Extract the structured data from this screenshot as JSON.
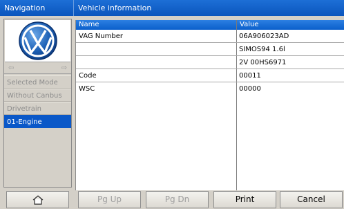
{
  "window": {
    "nav_title": "Navigation",
    "main_title": "Vehicle information"
  },
  "logo": {
    "brand": "VW",
    "icon": "vw-logo-icon"
  },
  "nav": {
    "arrow_left": "⇦",
    "arrow_right": "⇨",
    "items": [
      {
        "label": "Selected Mode",
        "selected": false
      },
      {
        "label": "Without Canbus",
        "selected": false
      },
      {
        "label": "Drivetrain",
        "selected": false
      },
      {
        "label": "01-Engine",
        "selected": true
      }
    ]
  },
  "table": {
    "headers": {
      "name": "Name",
      "value": "Value"
    },
    "rows": [
      {
        "name": "VAG Number",
        "value": "06A906023AD"
      },
      {
        "name": "",
        "value": "SIMOS94 1.6l"
      },
      {
        "name": "",
        "value": "2V 00HS6971"
      },
      {
        "name": "Code",
        "value": "00011"
      },
      {
        "name": "WSC",
        "value": "00000"
      }
    ]
  },
  "buttons": {
    "home_icon": "home-icon",
    "pgup": "Pg Up",
    "pgdn": "Pg Dn",
    "print": "Print",
    "cancel": "Cancel"
  },
  "colors": {
    "title_bar": "#0a55bd",
    "selection": "#0a58c8",
    "panel": "#d4d0c8"
  }
}
